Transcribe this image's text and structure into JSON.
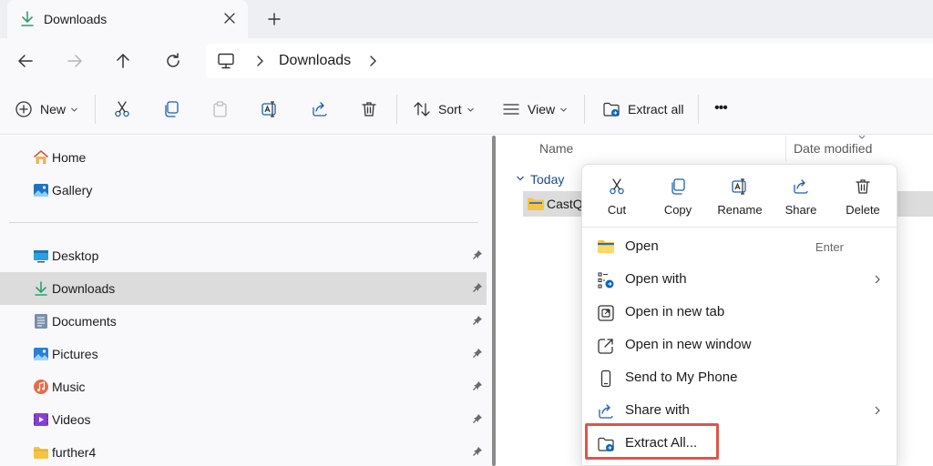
{
  "tab": {
    "title": "Downloads"
  },
  "address": {
    "crumb": "Downloads"
  },
  "commandbar": {
    "new_label": "New",
    "sort_label": "Sort",
    "view_label": "View",
    "extract_label": "Extract all",
    "more_label": "•••"
  },
  "sidebar": {
    "top_items": [
      {
        "label": "Home",
        "icon": "home-icon"
      },
      {
        "label": "Gallery",
        "icon": "gallery-icon"
      }
    ],
    "pinned_items": [
      {
        "label": "Desktop",
        "icon": "desktop-icon"
      },
      {
        "label": "Downloads",
        "icon": "download-icon",
        "selected": true
      },
      {
        "label": "Documents",
        "icon": "documents-icon"
      },
      {
        "label": "Pictures",
        "icon": "pictures-icon"
      },
      {
        "label": "Music",
        "icon": "music-icon"
      },
      {
        "label": "Videos",
        "icon": "videos-icon"
      },
      {
        "label": "further4",
        "icon": "folder-icon"
      }
    ]
  },
  "filepane": {
    "columns": {
      "name": "Name",
      "date_modified": "Date modified"
    },
    "group_label": "Today",
    "file_name": "CastQ"
  },
  "context_menu": {
    "quick_actions": [
      {
        "label": "Cut",
        "icon": "cut-icon"
      },
      {
        "label": "Copy",
        "icon": "copy-icon"
      },
      {
        "label": "Rename",
        "icon": "rename-icon"
      },
      {
        "label": "Share",
        "icon": "share-icon"
      },
      {
        "label": "Delete",
        "icon": "delete-icon"
      }
    ],
    "items": [
      {
        "label": "Open",
        "shortcut": "Enter",
        "icon": "folder-open-icon"
      },
      {
        "label": "Open with",
        "icon": "open-with-icon",
        "submenu": true
      },
      {
        "label": "Open in new tab",
        "icon": "new-tab-icon"
      },
      {
        "label": "Open in new window",
        "icon": "new-window-icon"
      },
      {
        "label": "Send to My Phone",
        "icon": "phone-icon"
      },
      {
        "label": "Share with",
        "icon": "share-with-icon",
        "submenu": true
      },
      {
        "label": "Extract All...",
        "icon": "extract-icon",
        "highlighted": true
      }
    ]
  },
  "colors": {
    "accent": "#0067c0",
    "highlight_border": "#e05548",
    "folder_yellow": "#f4c542",
    "download_green": "#2f9e6e"
  }
}
